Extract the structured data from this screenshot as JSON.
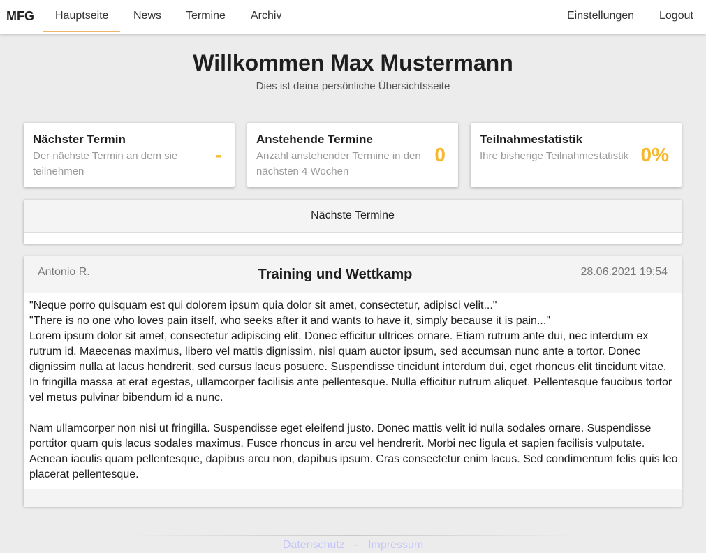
{
  "nav": {
    "brand": "MFG",
    "links": [
      "Hauptseite",
      "News",
      "Termine",
      "Archiv"
    ],
    "right": [
      "Einstellungen",
      "Logout"
    ],
    "active_color": "#f0b36a"
  },
  "hero": {
    "title": "Willkommen Max Mustermann",
    "subtitle": "Dies ist deine persönliche Übersichtsseite"
  },
  "stats": [
    {
      "title": "Nächster Termin",
      "desc": "Der nächste Termin an dem sie teilnehmen",
      "value": "-"
    },
    {
      "title": "Anstehende Termine",
      "desc": "Anzahl anstehender Termine in den nächsten 4 Wochen",
      "value": "0"
    },
    {
      "title": "Teilnahmestatistik",
      "desc": "Ihre bisherige Teilnahmestatistik",
      "value": "0%"
    }
  ],
  "upcoming": {
    "title": "Nächste Termine"
  },
  "post": {
    "author": "Antonio R.",
    "title": "Training und Wettkamp",
    "date": "28.06.2021 19:54",
    "lines": [
      "\"Neque porro quisquam est qui dolorem ipsum quia dolor sit amet, consectetur, adipisci velit...\"",
      "\"There is no one who loves pain itself, who seeks after it and wants to have it, simply because it is pain...\"",
      "Lorem ipsum dolor sit amet, consectetur adipiscing elit. Donec efficitur ultrices ornare. Etiam rutrum ante dui, nec interdum ex rutrum id. Maecenas maximus, libero vel mattis dignissim, nisl quam auctor ipsum, sed accumsan nunc ante a tortor. Donec dignissim nulla at lacus hendrerit, sed cursus lacus posuere. Suspendisse tincidunt interdum dui, eget rhoncus elit tincidunt vitae. In fringilla massa at erat egestas, ullamcorper facilisis ante pellentesque. Nulla efficitur rutrum aliquet. Pellentesque faucibus tortor vel metus pulvinar bibendum id a nunc.",
      "Nam ullamcorper non nisi ut fringilla. Suspendisse eget eleifend justo. Donec mattis velit id nulla sodales ornare. Suspendisse porttitor quam quis lacus sodales maximus. Fusce rhoncus in arcu vel hendrerit. Morbi nec ligula et sapien facilisis vulputate. Aenean iaculis quam pellentesque, dapibus arcu non, dapibus ipsum. Cras consectetur enim lacus. Sed condimentum felis quis leo placerat pellentesque."
    ]
  },
  "footer": {
    "links": [
      "Datenschutz",
      "Impressum"
    ],
    "separator": "-"
  },
  "colors": {
    "accent": "#f5b82e",
    "footer_link": "#c4c4ff",
    "background": "#ececec"
  }
}
